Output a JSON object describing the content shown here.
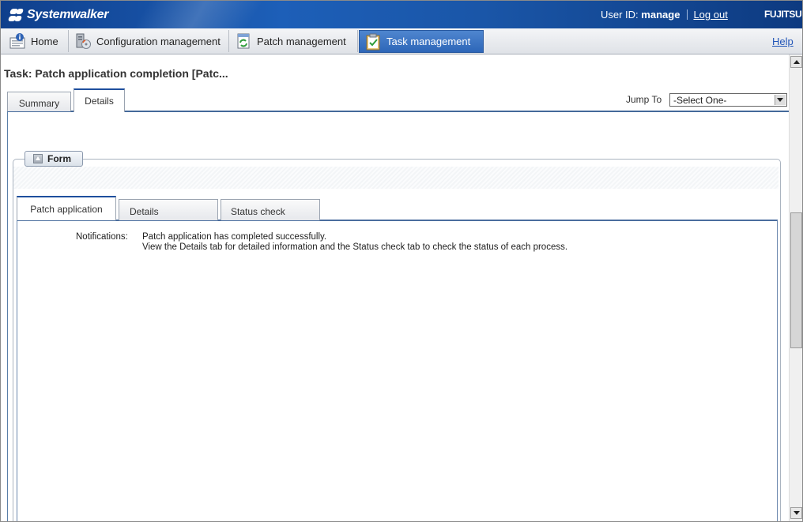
{
  "banner": {
    "product_name": "Systemwalker",
    "user_id_label": "User ID:",
    "user_id_value": "manage",
    "logout_label": "Log out",
    "vendor_logo": "FUJITSU"
  },
  "nav": {
    "tabs": [
      {
        "label": "Home",
        "icon": "home-info-icon"
      },
      {
        "label": "Configuration management",
        "icon": "server-cd-icon"
      },
      {
        "label": "Patch management",
        "icon": "patch-refresh-icon"
      },
      {
        "label": "Task management",
        "icon": "clipboard-check-icon",
        "active": true
      }
    ],
    "help_label": "Help"
  },
  "page": {
    "title": "Task: Patch application completion [Patc...",
    "tabs": [
      {
        "label": "Summary"
      },
      {
        "label": "Details",
        "selected": true
      }
    ],
    "jump_to_label": "Jump To",
    "jump_to_value": "-Select One-"
  },
  "form": {
    "header_label": "Form",
    "tabs": [
      {
        "label": "Patch application",
        "selected": true
      },
      {
        "label": "Details"
      },
      {
        "label": "Status check"
      }
    ],
    "notifications_label": "Notifications:",
    "notifications_line1": "Patch application has completed successfully.",
    "notifications_line2": "View the Details tab for detailed information and the Status check tab to check the status of each process."
  },
  "colors": {
    "banner": "#1d5fb8",
    "active_tab": "#2d66b8",
    "link": "#2256b8"
  }
}
